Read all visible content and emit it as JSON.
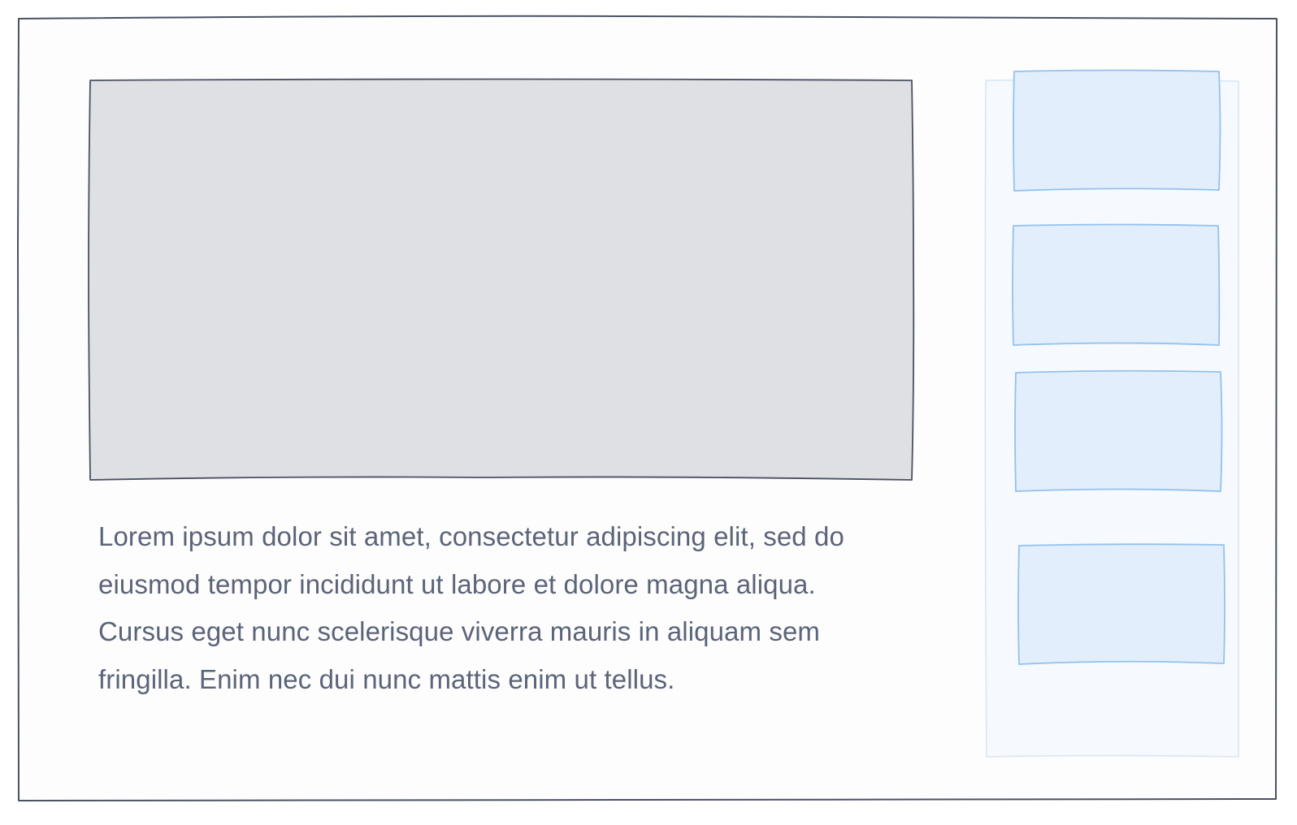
{
  "wireframe": {
    "body_text": "Lorem ipsum dolor sit amet, consectetur adipiscing elit, sed do\neiusmod tempor incididunt ut labore et dolore magna aliqua.\nCursus eget nunc scelerisque viverra mauris in aliquam sem\nfringilla. Enim nec dui nunc mattis enim ut tellus.",
    "thumbnail_count": 4
  },
  "colors": {
    "frame_stroke": "#4a5164",
    "media_fill": "#dfe0e3",
    "sidebar_fill": "#f6f9fd",
    "sidebar_stroke": "#d6e6f6",
    "thumb_fill": "#e2eefb",
    "thumb_stroke": "#92c2ee",
    "text": "#5b6478"
  }
}
